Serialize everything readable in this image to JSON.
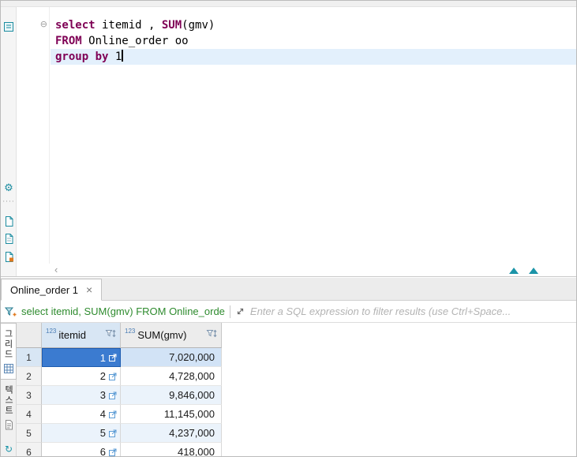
{
  "colors": {
    "keyword": "#7f0055",
    "selection_blue": "#3b7bd0",
    "filter_green": "#2e8b2e",
    "icon_teal": "#1b94a8",
    "zebra_blue": "#ebf3fb",
    "current_line": "#e3f0fc"
  },
  "editor": {
    "fold_marker": "⊖",
    "scroll_left_arrow": "‹",
    "lines": {
      "l1": {
        "k1": "select",
        "t1": " itemid , ",
        "k2": "SUM",
        "t2": "(gmv)"
      },
      "l2": {
        "k1": "FROM",
        "t1": " Online_order oo"
      },
      "l3": {
        "k1": "group by",
        "t1": " 1"
      }
    }
  },
  "results": {
    "tab_label": "Online_order 1",
    "tab_close": "×"
  },
  "filter": {
    "query_text": "select itemid, SUM(gmv) FROM Online_orde",
    "placeholder": "Enter a SQL expression to filter results (use Ctrl+Space..."
  },
  "side_tabs": {
    "grid": "그리드",
    "text": "텍스트"
  },
  "grid": {
    "columns": [
      {
        "badge": "123",
        "label": "itemid"
      },
      {
        "badge": "123",
        "label": "SUM(gmv)"
      }
    ],
    "rows": [
      {
        "num": "1",
        "itemid": "1",
        "gmv": "7,020,000"
      },
      {
        "num": "2",
        "itemid": "2",
        "gmv": "4,728,000"
      },
      {
        "num": "3",
        "itemid": "3",
        "gmv": "9,846,000"
      },
      {
        "num": "4",
        "itemid": "4",
        "gmv": "11,145,000"
      },
      {
        "num": "5",
        "itemid": "5",
        "gmv": "4,237,000"
      },
      {
        "num": "6",
        "itemid": "6",
        "gmv": "418,000"
      }
    ]
  }
}
